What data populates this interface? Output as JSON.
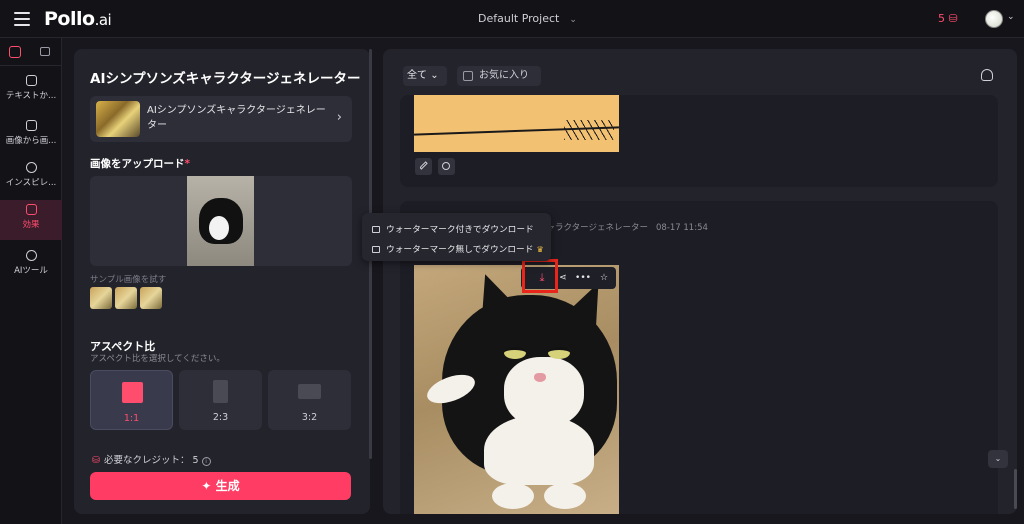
{
  "header": {
    "logo_main": "Pollo",
    "logo_suffix": ".ai",
    "project": "Default Project",
    "credits": "5"
  },
  "sidebar": {
    "items": [
      {
        "label": "テキストか..."
      },
      {
        "label": "画像から画..."
      },
      {
        "label": "インスピレ..."
      },
      {
        "label": "効果"
      },
      {
        "label": "AIツール"
      }
    ]
  },
  "left_panel": {
    "title": "AIシンプソンズキャラクタージェネレーター",
    "effect_name": "AIシンプソンズキャラクタージェネレーター",
    "upload_label": "画像をアップロード",
    "required_mark": "*",
    "sample_label": "サンプル画像を試す",
    "aspect_title": "アスペクト比",
    "aspect_sub": "アスペクト比を選択してください。",
    "aspect_options": [
      {
        "label": "1:1",
        "selected": true
      },
      {
        "label": "2:3",
        "selected": false
      },
      {
        "label": "3:2",
        "selected": false
      }
    ],
    "credit_label": "必要なクレジット：",
    "credit_value": "5",
    "generate_label": "生成"
  },
  "right_panel": {
    "filter_all": "全て",
    "filter_fav": "お気に入り",
    "card_meta": "キャラクタージェネレーター",
    "card_time": "08-17 11:54"
  },
  "download_menu": {
    "with_watermark": "ウォーターマーク付きでダウンロード",
    "without_watermark": "ウォーターマーク無しでダウンロード"
  },
  "colors": {
    "accent": "#ff3d64",
    "highlight_box": "#e8261c"
  }
}
